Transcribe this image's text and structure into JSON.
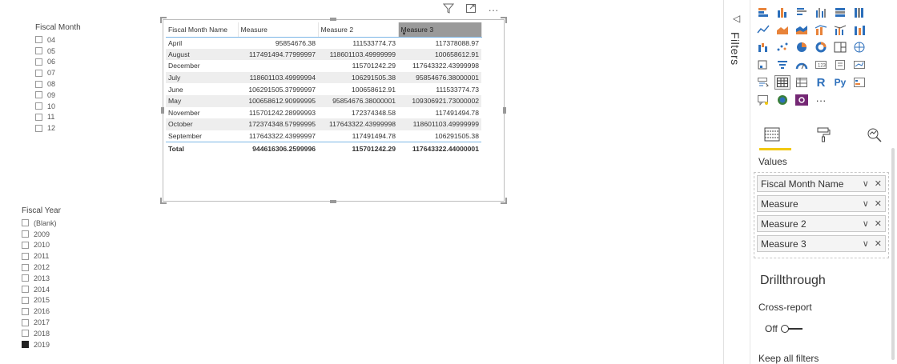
{
  "fiscal_month_slicer": {
    "title": "Fiscal Month",
    "items": [
      "04",
      "05",
      "06",
      "07",
      "08",
      "09",
      "10",
      "11",
      "12"
    ]
  },
  "fiscal_year_slicer": {
    "title": "Fiscal Year",
    "items": [
      "(Blank)",
      "2009",
      "2010",
      "2011",
      "2012",
      "2013",
      "2014",
      "2015",
      "2016",
      "2017",
      "2018",
      "2019"
    ],
    "selected": "2019"
  },
  "table": {
    "headers": [
      "Fiscal Month Name",
      "Measure",
      "Measure 2",
      "Measure 3"
    ],
    "rows": [
      [
        "April",
        "95854676.38",
        "111533774.73",
        "117378088.97"
      ],
      [
        "August",
        "117491494.77999997",
        "118601103.49999999",
        "100658612.91"
      ],
      [
        "December",
        "",
        "115701242.29",
        "117643322.43999998"
      ],
      [
        "July",
        "118601103.49999994",
        "106291505.38",
        "95854676.38000001"
      ],
      [
        "June",
        "106291505.37999997",
        "100658612.91",
        "111533774.73"
      ],
      [
        "May",
        "100658612.90999995",
        "95854676.38000001",
        "109306921.73000002"
      ],
      [
        "November",
        "115701242.28999993",
        "172374348.58",
        "117491494.78"
      ],
      [
        "October",
        "172374348.57999995",
        "117643322.43999998",
        "118601103.49999999"
      ],
      [
        "September",
        "117643322.43999997",
        "117491494.78",
        "106291505.38"
      ]
    ],
    "total": [
      "Total",
      "944616306.2599996",
      "115701242.29",
      "117643322.44000001"
    ]
  },
  "visual_header": {
    "filter_icon": "filter-icon",
    "focus_icon": "focus-mode-icon",
    "more_icon": "more-options-icon"
  },
  "filters_pane": {
    "label": "Filters"
  },
  "viz_pane": {
    "values_label": "Values",
    "wells": [
      "Fiscal Month Name",
      "Measure",
      "Measure 2",
      "Measure 3"
    ],
    "drillthrough_title": "Drillthrough",
    "cross_report_label": "Cross-report",
    "toggle_state": "Off",
    "keep_filters_label": "Keep all filters",
    "more_label": "···"
  },
  "colors": {
    "accent": "#f2c811",
    "header_underline": "#7cb6e6",
    "active_header": "#9a9a9a",
    "alt_row": "#eeeeee"
  }
}
